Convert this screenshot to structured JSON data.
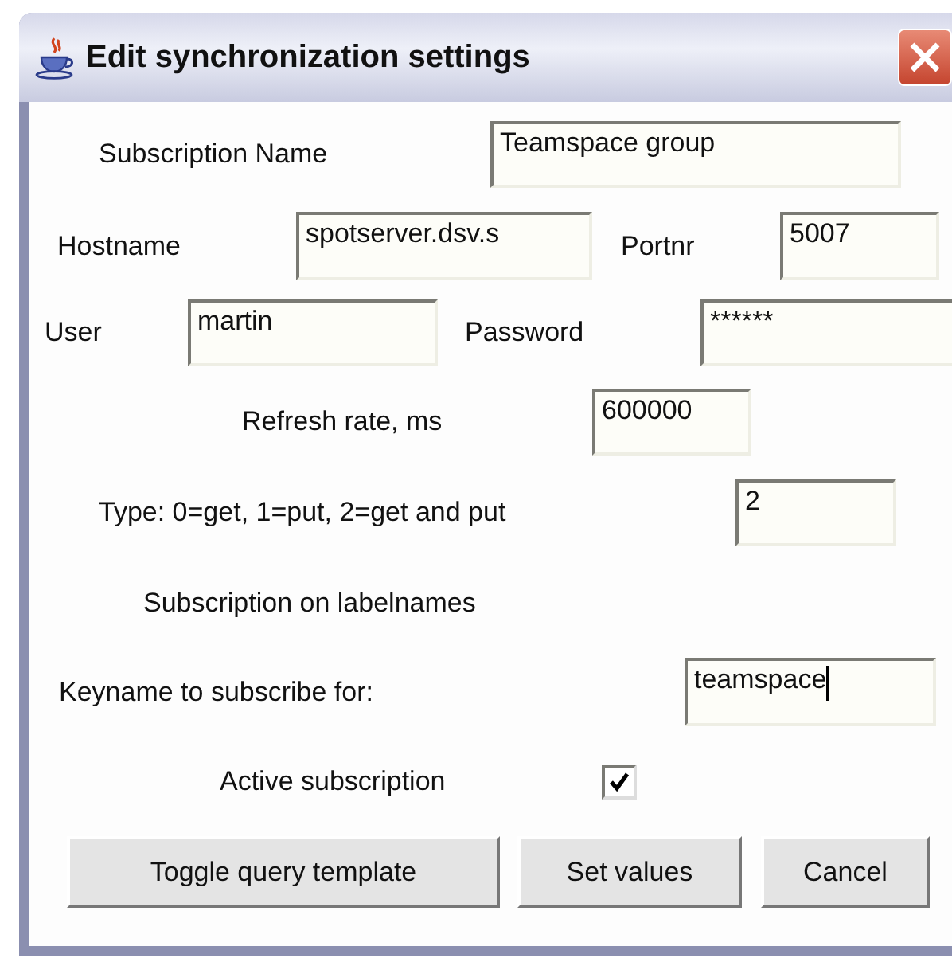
{
  "window": {
    "title": "Edit synchronization settings"
  },
  "rows": [
    {
      "kind": "fields",
      "items": [
        {
          "label": "Subscription Name",
          "value": "Teamspace group",
          "focused": false
        }
      ]
    },
    {
      "kind": "fields",
      "items": [
        {
          "label": "Hostname",
          "value": "spotserver.dsv.s",
          "focused": false
        },
        {
          "label": "Portnr",
          "value": "5007",
          "focused": false
        }
      ]
    },
    {
      "kind": "fields",
      "items": [
        {
          "label": "User",
          "value": "martin",
          "focused": false
        },
        {
          "label": "Password",
          "value": "******",
          "focused": false
        }
      ]
    },
    {
      "kind": "fields",
      "items": [
        {
          "label": "Refresh rate, ms",
          "value": "600000",
          "focused": false
        }
      ]
    },
    {
      "kind": "fields",
      "items": [
        {
          "label": "Type: 0=get, 1=put, 2=get and put",
          "value": "2",
          "focused": false
        }
      ]
    },
    {
      "kind": "heading",
      "text": "Subscription on labelnames"
    },
    {
      "kind": "fields",
      "items": [
        {
          "label": "Keyname to subscribe for:",
          "value": "teamspace",
          "focused": true
        }
      ]
    },
    {
      "kind": "checkbox",
      "label": "Active subscription",
      "checked": true
    },
    {
      "kind": "buttons",
      "buttons": [
        "Toggle query template",
        "Set values",
        "Cancel"
      ]
    }
  ]
}
